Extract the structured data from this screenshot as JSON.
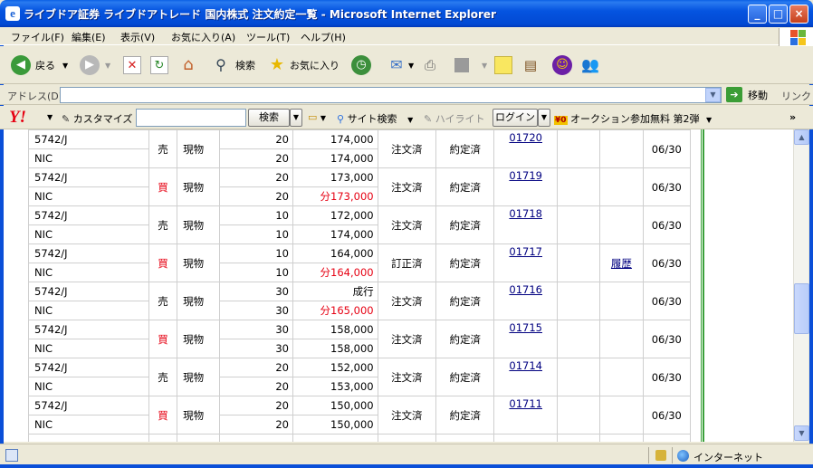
{
  "window": {
    "title": "ライブドア証券 ライブドアトレード 国内株式 注文約定一覧 - Microsoft Internet Explorer",
    "icon": "e",
    "min_label": "_",
    "max_label": "□",
    "close_label": "×"
  },
  "menu": [
    "ファイル(F)",
    "編集(E)",
    "表示(V)",
    "お気に入り(A)",
    "ツール(T)",
    "ヘルプ(H)"
  ],
  "toolbar": {
    "back": "戻る",
    "search": "検索",
    "favorites": "お気に入り"
  },
  "address": {
    "label": "アドレス(D)",
    "value": "",
    "go": "移動",
    "links": "リンク"
  },
  "yahoo": {
    "logo": "Y!",
    "customize": "カスタマイズ",
    "search_btn": "検索",
    "site_search": "サイト検索",
    "highlight": "ハイライト",
    "login": "ログイン",
    "auction_badge": "¥0",
    "auction": "オークション参加無料 第2弾"
  },
  "orders": [
    {
      "code": "5742/J",
      "name": "NIC",
      "side": "売",
      "kind": "現物",
      "qty1": "20",
      "qty2": "20",
      "price1": "174,000",
      "price2": "174,000",
      "price2_red": false,
      "ostat": "注文済",
      "estat": "約定済",
      "no": "01720",
      "hist": "",
      "date": "06/30"
    },
    {
      "code": "5742/J",
      "name": "NIC",
      "side": "買",
      "kind": "現物",
      "qty1": "20",
      "qty2": "20",
      "price1": "173,000",
      "price2": "分173,000",
      "price2_red": true,
      "ostat": "注文済",
      "estat": "約定済",
      "no": "01719",
      "hist": "",
      "date": "06/30"
    },
    {
      "code": "5742/J",
      "name": "NIC",
      "side": "売",
      "kind": "現物",
      "qty1": "10",
      "qty2": "10",
      "price1": "172,000",
      "price2": "174,000",
      "price2_red": false,
      "ostat": "注文済",
      "estat": "約定済",
      "no": "01718",
      "hist": "",
      "date": "06/30"
    },
    {
      "code": "5742/J",
      "name": "NIC",
      "side": "買",
      "kind": "現物",
      "qty1": "10",
      "qty2": "10",
      "price1": "164,000",
      "price2": "分164,000",
      "price2_red": true,
      "ostat": "訂正済",
      "estat": "約定済",
      "no": "01717",
      "hist": "履歴",
      "date": "06/30"
    },
    {
      "code": "5742/J",
      "name": "NIC",
      "side": "売",
      "kind": "現物",
      "qty1": "30",
      "qty2": "30",
      "price1": "成行",
      "price2": "分165,000",
      "price2_red": true,
      "ostat": "注文済",
      "estat": "約定済",
      "no": "01716",
      "hist": "",
      "date": "06/30"
    },
    {
      "code": "5742/J",
      "name": "NIC",
      "side": "買",
      "kind": "現物",
      "qty1": "30",
      "qty2": "30",
      "price1": "158,000",
      "price2": "158,000",
      "price2_red": false,
      "ostat": "注文済",
      "estat": "約定済",
      "no": "01715",
      "hist": "",
      "date": "06/30"
    },
    {
      "code": "5742/J",
      "name": "NIC",
      "side": "売",
      "kind": "現物",
      "qty1": "20",
      "qty2": "20",
      "price1": "152,000",
      "price2": "153,000",
      "price2_red": false,
      "ostat": "注文済",
      "estat": "約定済",
      "no": "01714",
      "hist": "",
      "date": "06/30"
    },
    {
      "code": "5742/J",
      "name": "NIC",
      "side": "買",
      "kind": "現物",
      "qty1": "20",
      "qty2": "20",
      "price1": "150,000",
      "price2": "150,000",
      "price2_red": false,
      "ostat": "注文済",
      "estat": "約定済",
      "no": "01711",
      "hist": "",
      "date": "06/30"
    },
    {
      "code": "",
      "name": "",
      "side": "",
      "kind": "",
      "qty1": "",
      "qty2": "",
      "price1": "",
      "price2": "",
      "price2_red": false,
      "ostat": "",
      "estat": "",
      "no": "",
      "hist": "",
      "date": ""
    }
  ],
  "status": {
    "zone": "インターネット"
  },
  "colors": {
    "buy": "#e60012",
    "link": "#000080",
    "frame": "#0a4fd8"
  }
}
